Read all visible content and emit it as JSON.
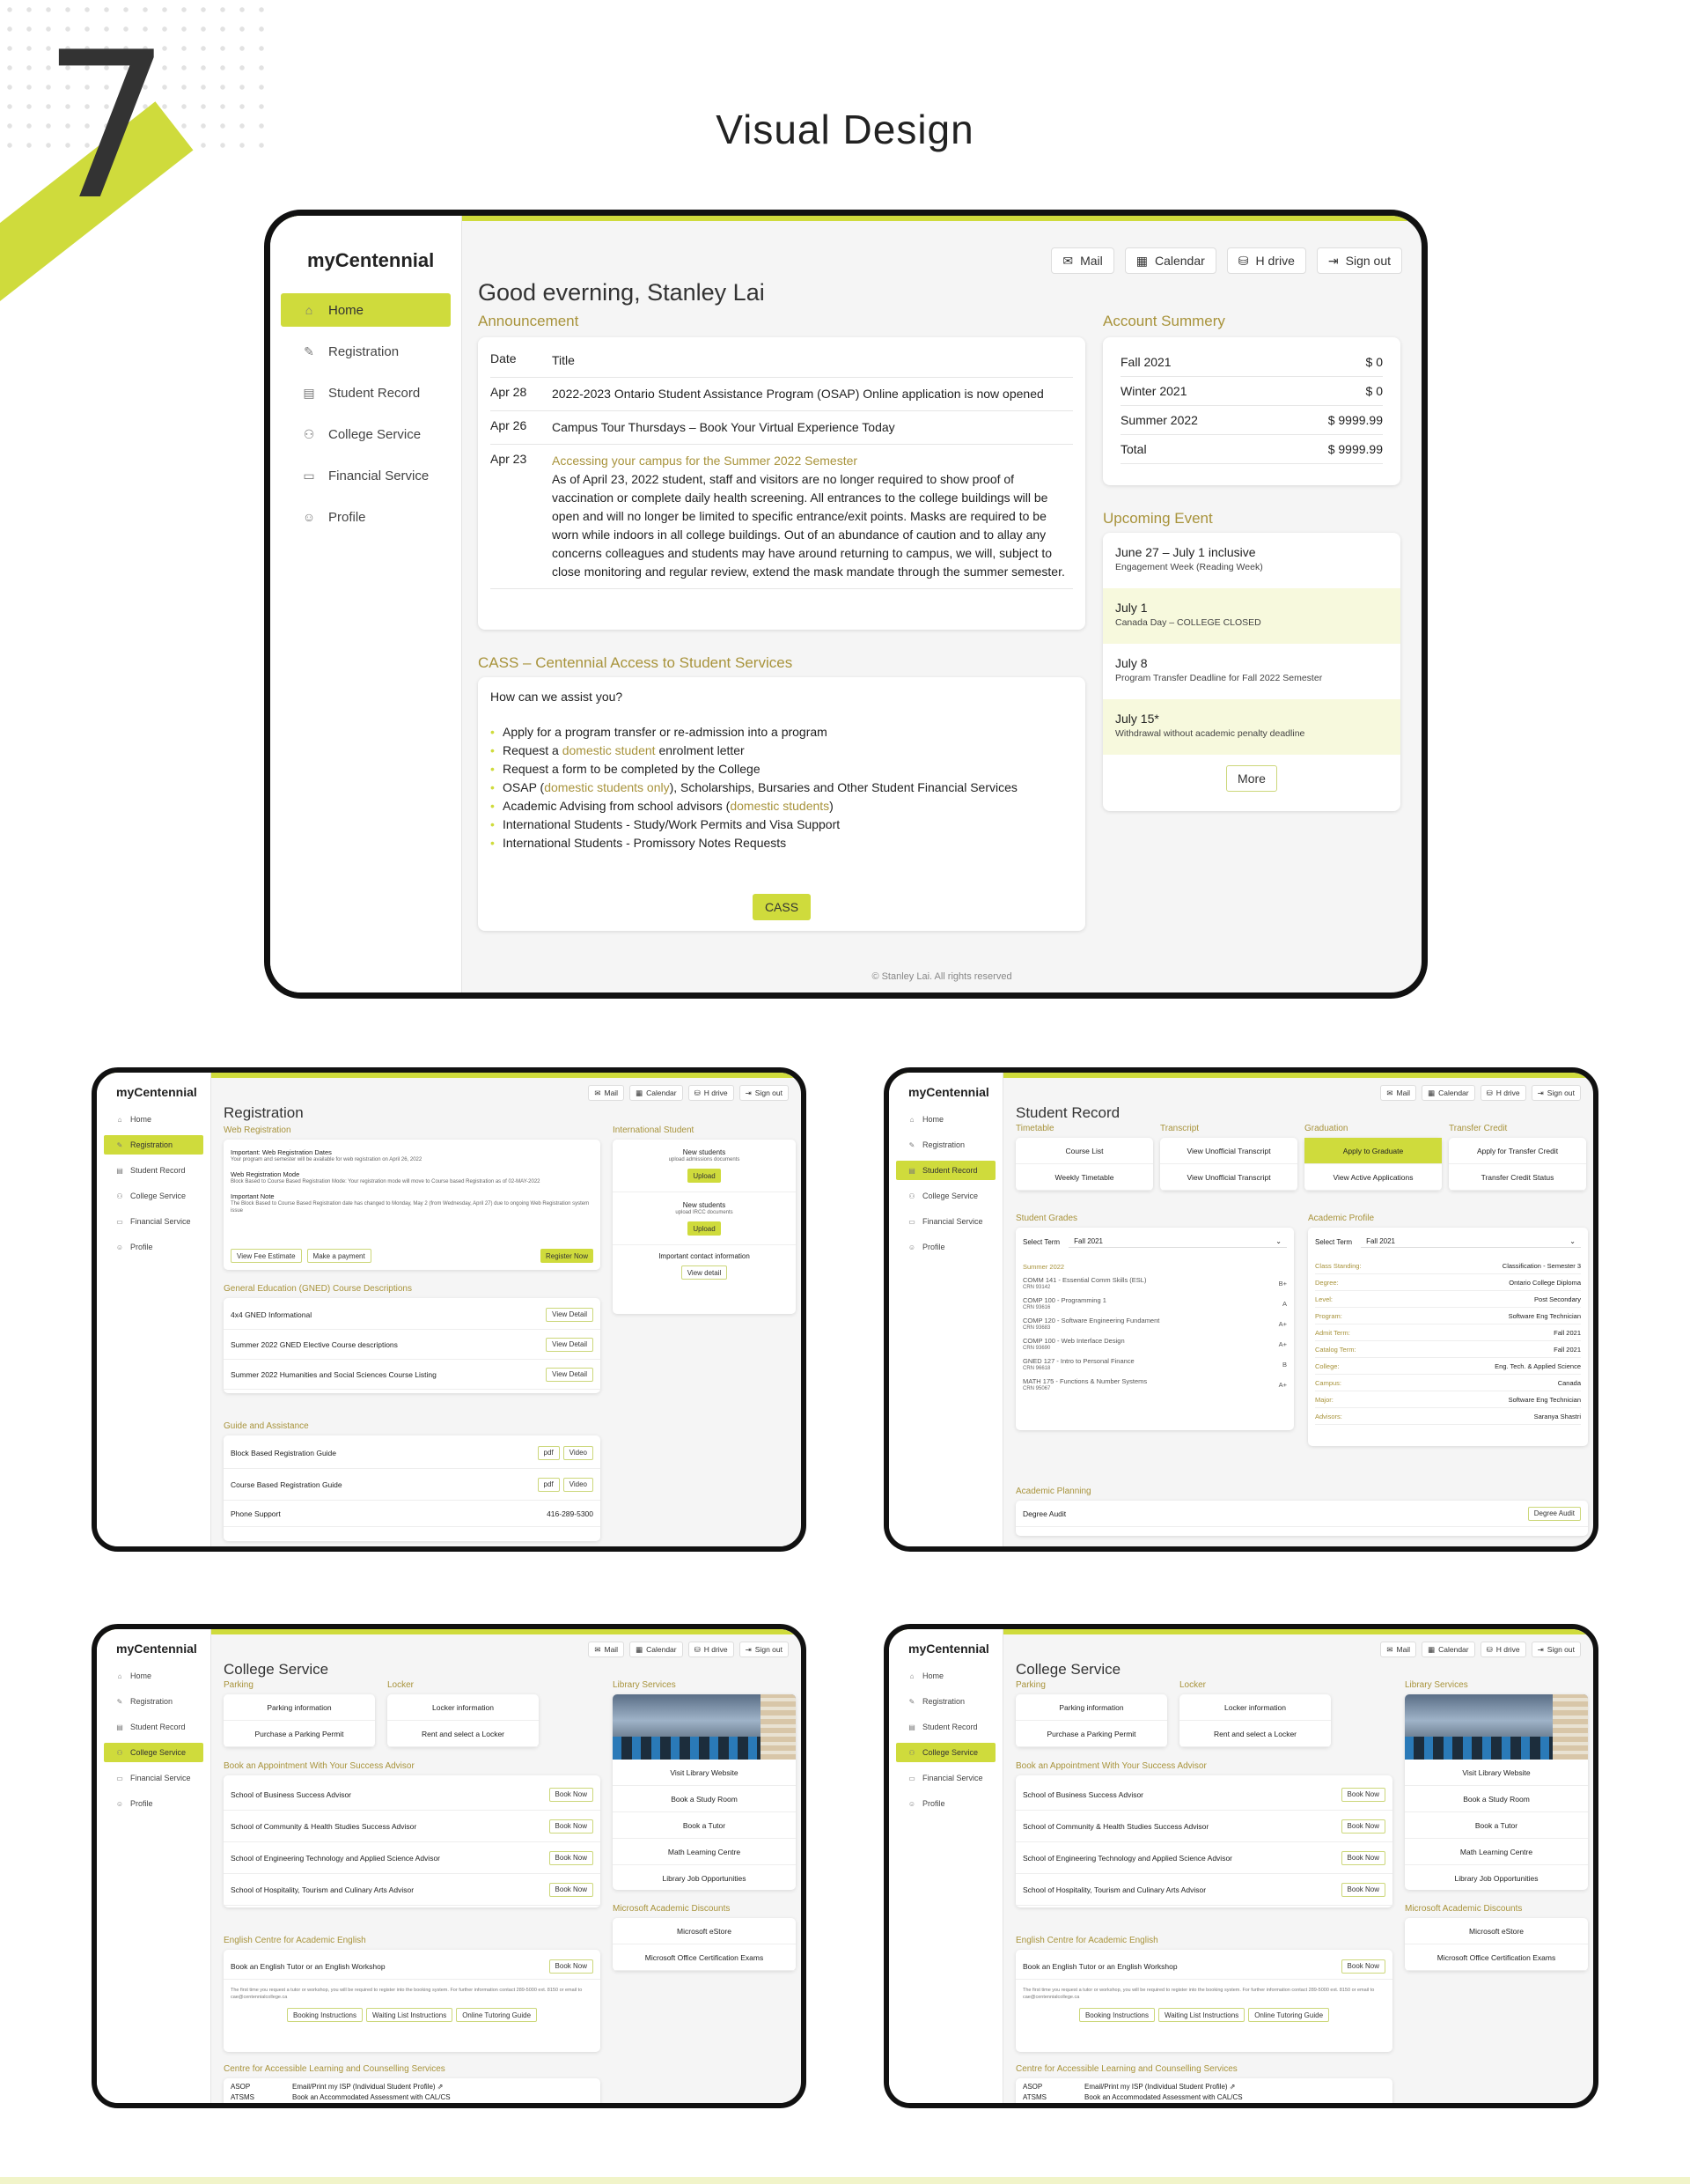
{
  "header": {
    "number": "7",
    "title": "Visual Design"
  },
  "app": {
    "brand": "myCentennial",
    "nav": [
      "Home",
      "Registration",
      "Student Record",
      "College Service",
      "Financial Service",
      "Profile"
    ],
    "toolbar": [
      "Mail",
      "Calendar",
      "H drive",
      "Sign out"
    ]
  },
  "home": {
    "greeting": "Good everning, Stanley Lai",
    "announcement_title": "Announcement",
    "ann_headers": {
      "date": "Date",
      "title": "Title"
    },
    "announcements": [
      {
        "date": "Apr 28",
        "title": "2022-2023 Ontario Student Assistance Program (OSAP) Online application is now opened"
      },
      {
        "date": "Apr 26",
        "title": "Campus Tour Thursdays – Book Your Virtual Experience Today"
      },
      {
        "date": "Apr 23",
        "link": "Accessing your campus for the Summer 2022 Semester",
        "title": "As of April 23, 2022 student, staff and visitors are no longer required to show proof of vaccination or complete daily health screening. All entrances to the college buildings will be open and will no longer be limited to specific entrance/exit points. Masks are required to be worn while indoors in all college buildings. Out of an abundance of caution and to allay any concerns colleagues and students may have around returning to campus, we will, subject to close monitoring and regular review, extend the mask mandate through the summer semester."
      }
    ],
    "cass_title": "CASS – Centennial Access to Student Services",
    "cass_question": "How can we assist you?",
    "cass_items": [
      {
        "pre": "Apply for a program transfer or re-admission into a program",
        "link": "",
        "post": ""
      },
      {
        "pre": "Request a ",
        "link": "domestic student",
        "post": " enrolment letter"
      },
      {
        "pre": "Request a form to be completed by the College",
        "link": "",
        "post": ""
      },
      {
        "pre": "OSAP (",
        "link": "domestic students only",
        "post": "), Scholarships, Bursaries and Other Student Financial Services"
      },
      {
        "pre": "Academic Advising from school advisors (",
        "link": "domestic students",
        "post": ")"
      },
      {
        "pre": "International Students - Study/Work Permits and Visa Support",
        "link": "",
        "post": ""
      },
      {
        "pre": "International Students - Promissory Notes Requests",
        "link": "",
        "post": ""
      }
    ],
    "cass_button": "CASS",
    "account_title": "Account Summery",
    "account": [
      {
        "term": "Fall 2021",
        "amount": "$ 0"
      },
      {
        "term": "Winter 2021",
        "amount": "$ 0"
      },
      {
        "term": "Summer 2022",
        "amount": "$ 9999.99"
      },
      {
        "term": "Total",
        "amount": "$ 9999.99"
      }
    ],
    "events_title": "Upcoming Event",
    "events": [
      {
        "date": "June 27 – July 1 inclusive",
        "desc": "Engagement Week (Reading Week)"
      },
      {
        "date": "July 1",
        "desc": "Canada Day – COLLEGE CLOSED"
      },
      {
        "date": "July 8",
        "desc": "Program Transfer Deadline for Fall 2022 Semester"
      },
      {
        "date": "July 15*",
        "desc": "Withdrawal without academic penalty deadline"
      }
    ],
    "more_button": "More",
    "footer": "© Stanley Lai. All rights reserved"
  },
  "registration": {
    "title": "Registration",
    "web_title": "Web Registration",
    "notes": [
      {
        "head": "Important: Web Registration Dates",
        "body": "Your program and semester will be available for web registration on April 26, 2022"
      },
      {
        "head": "Web Registration Mode",
        "body": "Block Based to Course Based Registration Mode: Your registration mode will move to Course based Registration as of 02-MAY-2022"
      },
      {
        "head": "Important Note",
        "body": "The Block Based to Course Based Registration date has changed to Monday, May 2 (from Wednesday, April 27) due to ongoing Web Registration system issue"
      }
    ],
    "btn_fee": "View Fee Estimate",
    "btn_pay": "Make a payment",
    "btn_register": "Register Now",
    "gned_title": "General Education (GNED) Course Descriptions",
    "gned": [
      "4x4 GNED Informational",
      "Summer 2022 GNED Elective Course descriptions",
      "Summer 2022 Humanities and Social Sciences Course Listing"
    ],
    "view_detail": "View Detail",
    "guide_title": "Guide and Assistance",
    "guides": [
      "Block Based Registration Guide",
      "Course Based Registration Guide"
    ],
    "pdf": "pdf",
    "video": "Video",
    "phone_label": "Phone Support",
    "phone": "416-289-5300",
    "intl_title": "International Student",
    "intl": [
      {
        "head": "New students",
        "body": "upload admissions documents",
        "btn": "Upload"
      },
      {
        "head": "New students",
        "body": "upload IRCC documents",
        "btn": "Upload"
      }
    ],
    "contact": "Important contact information",
    "view_detail_lc": "View detail"
  },
  "record": {
    "title": "Student Record",
    "cols": [
      {
        "title": "Timetable",
        "items": [
          "Course List",
          "Weekly Timetable"
        ]
      },
      {
        "title": "Transcript",
        "items": [
          "View Unofficial Transcript",
          "View Unofficial Transcript"
        ]
      },
      {
        "title": "Graduation",
        "items": [
          "Apply to Graduate",
          "View Active Applications"
        ]
      },
      {
        "title": "Transfer Credit",
        "items": [
          "Apply for Transfer Credit",
          "Transfer Credit Status"
        ]
      }
    ],
    "grades_title": "Student Grades",
    "select_label": "Select Term",
    "select_value": "Fall 2021",
    "term": "Summer 2022",
    "courses": [
      {
        "name": "COMM 141 - Essential Comm Skills (ESL)",
        "crn": "CRN 93142",
        "grade": "B+"
      },
      {
        "name": "COMP 100 - Programming 1",
        "crn": "CRN 93616",
        "grade": "A"
      },
      {
        "name": "COMP 120 - Software Engineering Fundament",
        "crn": "CRN 93683",
        "grade": "A+"
      },
      {
        "name": "COMP 100 - Web Interface Design",
        "crn": "CRN 93690",
        "grade": "A+"
      },
      {
        "name": "GNED 127 - Intro to Personal Finance",
        "crn": "CRN 96618",
        "grade": "B"
      },
      {
        "name": "MATH 175 - Functions & Number Systems",
        "crn": "CRN 95067",
        "grade": "A+"
      }
    ],
    "profile_title": "Academic Profile",
    "profile": [
      {
        "k": "Class Standing:",
        "v": "Classification - Semester 3"
      },
      {
        "k": "Degree:",
        "v": "Ontario College Diploma"
      },
      {
        "k": "Level:",
        "v": "Post Secondary"
      },
      {
        "k": "Program:",
        "v": "Software Eng Technician"
      },
      {
        "k": "Admit Term:",
        "v": "Fall 2021"
      },
      {
        "k": "Catalog Term:",
        "v": "Fall 2021"
      },
      {
        "k": "College:",
        "v": "Eng. Tech. & Applied Science"
      },
      {
        "k": "Campus:",
        "v": "Canada"
      },
      {
        "k": "Major:",
        "v": "Software Eng Technician"
      },
      {
        "k": "Advisors:",
        "v": "Saranya Shastri"
      }
    ],
    "planning_title": "Academic Planning",
    "degree_audit": "Degree Audit",
    "degree_audit_btn": "Degree Audit"
  },
  "college": {
    "title": "College Service",
    "parking_title": "Parking",
    "parking": [
      "Parking information",
      "Purchase a Parking Permit"
    ],
    "locker_title": "Locker",
    "locker": [
      "Locker information",
      "Rent and select a Locker"
    ],
    "advisor_title": "Book an Appointment With Your Success Advisor",
    "advisors": [
      "School of Business Success Advisor",
      "School of Community & Health Studies Success Advisor",
      "School of Engineering Technology and Applied Science Advisor",
      "School of Hospitality, Tourism and Culinary Arts Advisor"
    ],
    "book_now": "Book Now",
    "english_title": "English Centre for Academic English",
    "english_item": "Book an English Tutor or an English Workshop",
    "english_note": "The first time you request a tutor or workshop, you will be required to register into the booking system. For further information contact 289-5000 ext. 8150 or email to cae@centennialcollege.ca",
    "english_btns": [
      "Booking Instructions",
      "Waiting List Instructions",
      "Online Tutoring Guide"
    ],
    "cal_title": "Centre for Accessible Learning and Counselling Services",
    "cal": [
      {
        "k": "ASOP",
        "v": "Email/Print my ISP (Individual Student Profile) ⇗"
      },
      {
        "k": "ATSMS",
        "v": "Book an Accommodated Assessment with CAL/CS"
      }
    ],
    "library_title": "Library Services",
    "library": [
      "Visit Library Website",
      "Book a Study Room",
      "Book a Tutor",
      "Math Learning Centre",
      "Library Job Opportunities"
    ],
    "ms_title": "Microsoft Academic Discounts",
    "ms": [
      "Microsoft eStore",
      "Microsoft Office Certification Exams"
    ]
  }
}
